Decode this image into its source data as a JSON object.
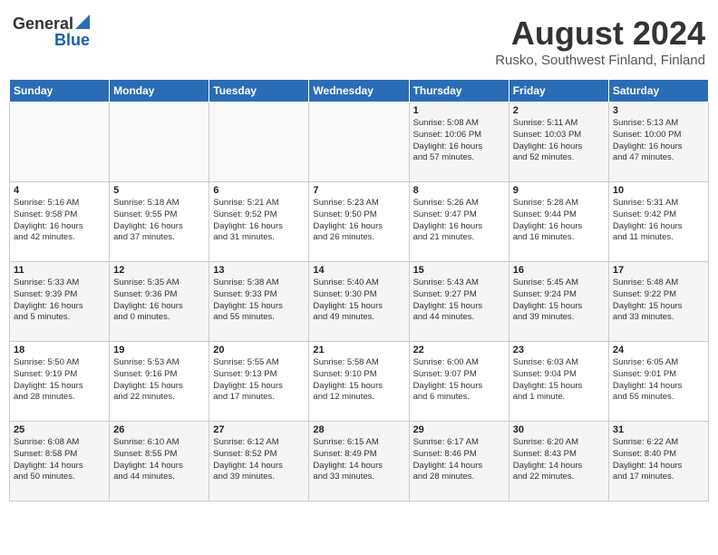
{
  "logo": {
    "general": "General",
    "blue": "Blue"
  },
  "header": {
    "month_year": "August 2024",
    "location": "Rusko, Southwest Finland, Finland"
  },
  "days_of_week": [
    "Sunday",
    "Monday",
    "Tuesday",
    "Wednesday",
    "Thursday",
    "Friday",
    "Saturday"
  ],
  "weeks": [
    [
      {
        "day": "",
        "info": ""
      },
      {
        "day": "",
        "info": ""
      },
      {
        "day": "",
        "info": ""
      },
      {
        "day": "",
        "info": ""
      },
      {
        "day": "1",
        "info": "Sunrise: 5:08 AM\nSunset: 10:06 PM\nDaylight: 16 hours\nand 57 minutes."
      },
      {
        "day": "2",
        "info": "Sunrise: 5:11 AM\nSunset: 10:03 PM\nDaylight: 16 hours\nand 52 minutes."
      },
      {
        "day": "3",
        "info": "Sunrise: 5:13 AM\nSunset: 10:00 PM\nDaylight: 16 hours\nand 47 minutes."
      }
    ],
    [
      {
        "day": "4",
        "info": "Sunrise: 5:16 AM\nSunset: 9:58 PM\nDaylight: 16 hours\nand 42 minutes."
      },
      {
        "day": "5",
        "info": "Sunrise: 5:18 AM\nSunset: 9:55 PM\nDaylight: 16 hours\nand 37 minutes."
      },
      {
        "day": "6",
        "info": "Sunrise: 5:21 AM\nSunset: 9:52 PM\nDaylight: 16 hours\nand 31 minutes."
      },
      {
        "day": "7",
        "info": "Sunrise: 5:23 AM\nSunset: 9:50 PM\nDaylight: 16 hours\nand 26 minutes."
      },
      {
        "day": "8",
        "info": "Sunrise: 5:26 AM\nSunset: 9:47 PM\nDaylight: 16 hours\nand 21 minutes."
      },
      {
        "day": "9",
        "info": "Sunrise: 5:28 AM\nSunset: 9:44 PM\nDaylight: 16 hours\nand 16 minutes."
      },
      {
        "day": "10",
        "info": "Sunrise: 5:31 AM\nSunset: 9:42 PM\nDaylight: 16 hours\nand 11 minutes."
      }
    ],
    [
      {
        "day": "11",
        "info": "Sunrise: 5:33 AM\nSunset: 9:39 PM\nDaylight: 16 hours\nand 5 minutes."
      },
      {
        "day": "12",
        "info": "Sunrise: 5:35 AM\nSunset: 9:36 PM\nDaylight: 16 hours\nand 0 minutes."
      },
      {
        "day": "13",
        "info": "Sunrise: 5:38 AM\nSunset: 9:33 PM\nDaylight: 15 hours\nand 55 minutes."
      },
      {
        "day": "14",
        "info": "Sunrise: 5:40 AM\nSunset: 9:30 PM\nDaylight: 15 hours\nand 49 minutes."
      },
      {
        "day": "15",
        "info": "Sunrise: 5:43 AM\nSunset: 9:27 PM\nDaylight: 15 hours\nand 44 minutes."
      },
      {
        "day": "16",
        "info": "Sunrise: 5:45 AM\nSunset: 9:24 PM\nDaylight: 15 hours\nand 39 minutes."
      },
      {
        "day": "17",
        "info": "Sunrise: 5:48 AM\nSunset: 9:22 PM\nDaylight: 15 hours\nand 33 minutes."
      }
    ],
    [
      {
        "day": "18",
        "info": "Sunrise: 5:50 AM\nSunset: 9:19 PM\nDaylight: 15 hours\nand 28 minutes."
      },
      {
        "day": "19",
        "info": "Sunrise: 5:53 AM\nSunset: 9:16 PM\nDaylight: 15 hours\nand 22 minutes."
      },
      {
        "day": "20",
        "info": "Sunrise: 5:55 AM\nSunset: 9:13 PM\nDaylight: 15 hours\nand 17 minutes."
      },
      {
        "day": "21",
        "info": "Sunrise: 5:58 AM\nSunset: 9:10 PM\nDaylight: 15 hours\nand 12 minutes."
      },
      {
        "day": "22",
        "info": "Sunrise: 6:00 AM\nSunset: 9:07 PM\nDaylight: 15 hours\nand 6 minutes."
      },
      {
        "day": "23",
        "info": "Sunrise: 6:03 AM\nSunset: 9:04 PM\nDaylight: 15 hours\nand 1 minute."
      },
      {
        "day": "24",
        "info": "Sunrise: 6:05 AM\nSunset: 9:01 PM\nDaylight: 14 hours\nand 55 minutes."
      }
    ],
    [
      {
        "day": "25",
        "info": "Sunrise: 6:08 AM\nSunset: 8:58 PM\nDaylight: 14 hours\nand 50 minutes."
      },
      {
        "day": "26",
        "info": "Sunrise: 6:10 AM\nSunset: 8:55 PM\nDaylight: 14 hours\nand 44 minutes."
      },
      {
        "day": "27",
        "info": "Sunrise: 6:12 AM\nSunset: 8:52 PM\nDaylight: 14 hours\nand 39 minutes."
      },
      {
        "day": "28",
        "info": "Sunrise: 6:15 AM\nSunset: 8:49 PM\nDaylight: 14 hours\nand 33 minutes."
      },
      {
        "day": "29",
        "info": "Sunrise: 6:17 AM\nSunset: 8:46 PM\nDaylight: 14 hours\nand 28 minutes."
      },
      {
        "day": "30",
        "info": "Sunrise: 6:20 AM\nSunset: 8:43 PM\nDaylight: 14 hours\nand 22 minutes."
      },
      {
        "day": "31",
        "info": "Sunrise: 6:22 AM\nSunset: 8:40 PM\nDaylight: 14 hours\nand 17 minutes."
      }
    ]
  ]
}
